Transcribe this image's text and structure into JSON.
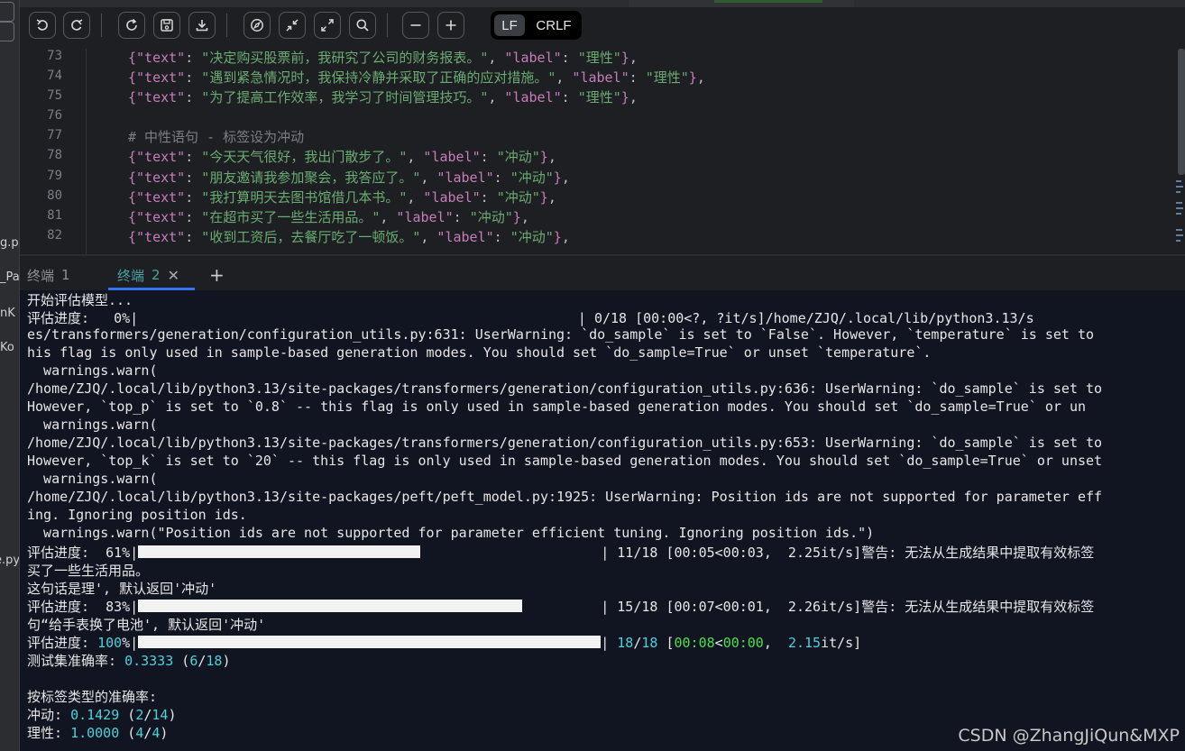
{
  "left_strip": {
    "fragments": [
      "g.p",
      "_Pa",
      "nK",
      "Ko",
      "e.py"
    ]
  },
  "toolbar": {
    "buttons": [
      {
        "name": "undo-button",
        "icon": "undo-icon"
      },
      {
        "name": "redo-button",
        "icon": "redo-icon"
      },
      {
        "name": "refresh-button",
        "icon": "refresh-icon"
      },
      {
        "name": "save-button",
        "icon": "save-icon"
      },
      {
        "name": "download-button",
        "icon": "download-icon"
      },
      {
        "name": "navigate-button",
        "icon": "compass-icon"
      },
      {
        "name": "collapse-button",
        "icon": "collapse-icon"
      },
      {
        "name": "expand-button",
        "icon": "expand-icon"
      },
      {
        "name": "search-button",
        "icon": "search-icon"
      },
      {
        "name": "zoom-out-button",
        "icon": "minus-icon"
      },
      {
        "name": "zoom-in-button",
        "icon": "plus-icon"
      }
    ],
    "eol": {
      "lf": "LF",
      "crlf": "CRLF",
      "selected": "LF"
    }
  },
  "editor": {
    "lines": [
      {
        "num": "73",
        "text": "决定购买股票前，我研究了公司的财务报表。",
        "label": "理性"
      },
      {
        "num": "74",
        "text": "遇到紧急情况时，我保持冷静并采取了正确的应对措施。",
        "label": "理性"
      },
      {
        "num": "75",
        "text": "为了提高工作效率，我学习了时间管理技巧。",
        "label": "理性"
      },
      {
        "num": "76",
        "text": "",
        "label": ""
      },
      {
        "num": "77",
        "comment": "# 中性语句 - 标签设为冲动"
      },
      {
        "num": "78",
        "text": "今天天气很好，我出门散步了。",
        "label": "冲动"
      },
      {
        "num": "79",
        "text": "朋友邀请我参加聚会，我答应了。",
        "label": "冲动"
      },
      {
        "num": "80",
        "text": "我打算明天去图书馆借几本书。",
        "label": "冲动"
      },
      {
        "num": "81",
        "text": "在超市买了一些生活用品。",
        "label": "冲动"
      },
      {
        "num": "82",
        "text": "收到工资后，去餐厅吃了一顿饭。",
        "label": "冲动"
      }
    ],
    "key_text": "\"text\"",
    "key_label": "\"label\""
  },
  "terminal_tabs": {
    "tab1": {
      "label": "终端",
      "num": "1"
    },
    "tab2": {
      "label": "终端",
      "num": "2",
      "active": true
    },
    "close_glyph": "✕",
    "add_glyph": "+"
  },
  "terminal": {
    "lines": [
      "开始评估模型...",
      "评估进度:   0%|                                                      | 0/18 [00:00<?, ?it/s]/home/ZJQ/.local/lib/python3.13/s",
      "es/transformers/generation/configuration_utils.py:631: UserWarning: `do_sample` is set to `False`. However, `temperature` is set to",
      "his flag is only used in sample-based generation modes. You should set `do_sample=True` or unset `temperature`.",
      "  warnings.warn(",
      "/home/ZJQ/.local/lib/python3.13/site-packages/transformers/generation/configuration_utils.py:636: UserWarning: `do_sample` is set to",
      "However, `top_p` is set to `0.8` -- this flag is only used in sample-based generation modes. You should set `do_sample=True` or un",
      "  warnings.warn(",
      "/home/ZJQ/.local/lib/python3.13/site-packages/transformers/generation/configuration_utils.py:653: UserWarning: `do_sample` is set to",
      "However, `top_k` is set to `20` -- this flag is only used in sample-based generation modes. You should set `do_sample=True` or unset",
      "  warnings.warn(",
      "/home/ZJQ/.local/lib/python3.13/site-packages/peft/peft_model.py:1925: UserWarning: Position ids are not supported for parameter eff",
      "ing. Ignoring position ids.",
      "  warnings.warn(\"Position ids are not supported for parameter efficient tuning. Ignoring position ids.\")"
    ],
    "progress_61": {
      "prefix": "评估进度:  61%|",
      "fraction": 0.61,
      "suffix": "| 11/18 [00:05<00:03,  2.25it/s]警告: 无法从生成结果中提取有效标签"
    },
    "line_after_61": "买了一些生活用品。",
    "line_after_61b": "这句话是理', 默认返回'冲动'",
    "progress_83": {
      "prefix": "评估进度:  83%|",
      "fraction": 0.83,
      "suffix": "| 15/18 [00:07<00:01,  2.26it/s]警告: 无法从生成结果中提取有效标签"
    },
    "line_after_83": "句“给手表换了电池', 默认返回'冲动'",
    "progress_100": {
      "prefix": "评估进度: ",
      "pct": "100",
      "pct_sign": "%|",
      "fraction": 1.0,
      "a": "18",
      "slash": "/",
      "b": "18",
      "bracket_open": " [",
      "t1": "00:08",
      "lt": "<",
      "t2": "00:00",
      "comma": ",  ",
      "rate": "2.15",
      "rate_unit": "it/s]"
    },
    "accuracy_label": "测试集准确率: ",
    "accuracy_value": "0.3333",
    "accuracy_frac_open": " (",
    "accuracy_num": "6",
    "accuracy_den": "18",
    "accuracy_close": ")",
    "by_label_header": "按标签类型的准确率:",
    "impulsive": {
      "label": "冲动: ",
      "value": "0.1429",
      "num": "2",
      "den": "14"
    },
    "rational": {
      "label": "理性: ",
      "value": "1.0000",
      "num": "4",
      "den": "4"
    }
  },
  "watermark": "CSDN @ZhangJiQun&MXP"
}
